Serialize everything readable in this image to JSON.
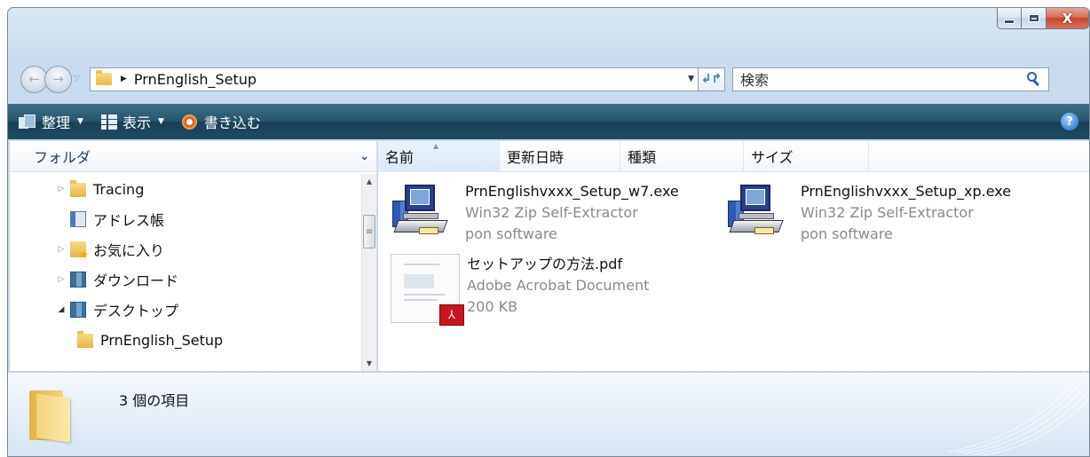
{
  "window": {
    "close_glyph": "X"
  },
  "nav": {
    "back_glyph": "←",
    "forward_glyph": "→",
    "breadcrumb": "PrnEnglish_Setup",
    "refresh_glyph": "↲↱",
    "search_placeholder": "検索"
  },
  "commands": {
    "organize": "整理",
    "views": "表示",
    "burn": "書き込む",
    "help_glyph": "?"
  },
  "folder_pane": {
    "header": "フォルダ",
    "items": [
      {
        "label": "Tracing",
        "arrow": "▷",
        "icon": "folder-icon"
      },
      {
        "label": "アドレス帳",
        "arrow": "",
        "icon": "address-book-icon"
      },
      {
        "label": "お気に入り",
        "arrow": "▷",
        "icon": "favorites-icon"
      },
      {
        "label": "ダウンロード",
        "arrow": "▷",
        "icon": "downloads-icon"
      },
      {
        "label": "デスクトップ",
        "arrow": "◢",
        "icon": "desktop-icon"
      },
      {
        "label": "PrnEnglish_Setup",
        "arrow": "",
        "icon": "folder-icon"
      }
    ]
  },
  "columns": {
    "name": "名前",
    "date": "更新日時",
    "type": "種類",
    "size": "サイズ"
  },
  "files": [
    {
      "name": "PrnEnglishvxxx_Setup_w7.exe",
      "line2": "Win32 Zip Self-Extractor",
      "line3": "pon software",
      "icon": "installer-icon"
    },
    {
      "name": "PrnEnglishvxxx_Setup_xp.exe",
      "line2": "Win32 Zip Self-Extractor",
      "line3": "pon software",
      "icon": "installer-icon"
    },
    {
      "name": "セットアップの方法.pdf",
      "line2": "Adobe Acrobat Document",
      "line3": "200 KB",
      "icon": "pdf-icon"
    }
  ],
  "details": {
    "item_count": "3 個の項目"
  }
}
